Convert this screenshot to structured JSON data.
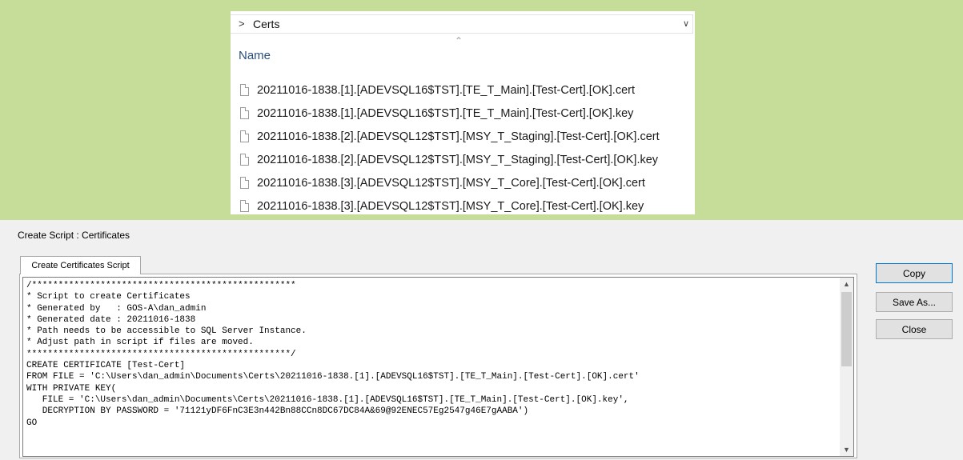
{
  "explorer": {
    "breadcrumb_separator": ">",
    "breadcrumb": "Certs",
    "column_header": "Name",
    "files": [
      "20211016-1838.[1].[ADEVSQL16$TST].[TE_T_Main].[Test-Cert].[OK].cert",
      "20211016-1838.[1].[ADEVSQL16$TST].[TE_T_Main].[Test-Cert].[OK].key",
      "20211016-1838.[2].[ADEVSQL12$TST].[MSY_T_Staging].[Test-Cert].[OK].cert",
      "20211016-1838.[2].[ADEVSQL12$TST].[MSY_T_Staging].[Test-Cert].[OK].key",
      "20211016-1838.[3].[ADEVSQL12$TST].[MSY_T_Core].[Test-Cert].[OK].cert",
      "20211016-1838.[3].[ADEVSQL12$TST].[MSY_T_Core].[Test-Cert].[OK].key"
    ]
  },
  "dialog": {
    "title": "Create Script : Certificates",
    "tab_label": "Create Certificates Script",
    "script_lines": [
      "/**************************************************",
      "* Script to create Certificates",
      "* Generated by   : GOS-A\\dan_admin",
      "* Generated date : 20211016-1838",
      "* Path needs to be accessible to SQL Server Instance.",
      "* Adjust path in script if files are moved.",
      "**************************************************/",
      "CREATE CERTIFICATE [Test-Cert]",
      "FROM FILE = 'C:\\Users\\dan_admin\\Documents\\Certs\\20211016-1838.[1].[ADEVSQL16$TST].[TE_T_Main].[Test-Cert].[OK].cert'",
      "WITH PRIVATE KEY(",
      "   FILE = 'C:\\Users\\dan_admin\\Documents\\Certs\\20211016-1838.[1].[ADEVSQL16$TST].[TE_T_Main].[Test-Cert].[OK].key',",
      "   DECRYPTION BY PASSWORD = '71121yDF6FnC3E3n442Bn88CCn8DC67DC84A&69@92ENEC57Eg2547g46E7gAABA')",
      "GO"
    ],
    "buttons": {
      "copy": "Copy",
      "save_as": "Save As...",
      "close": "Close"
    }
  }
}
